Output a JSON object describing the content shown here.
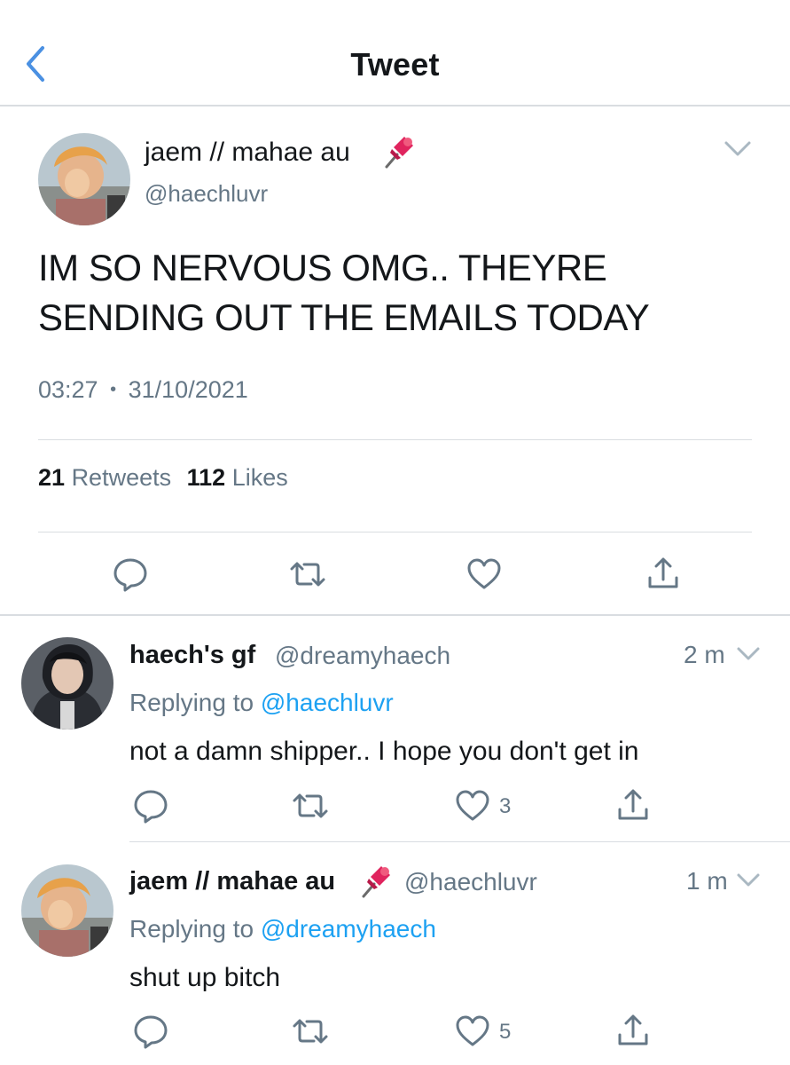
{
  "header": {
    "title": "Tweet"
  },
  "main_tweet": {
    "display_name": "jaem // mahae au",
    "badge_emoji": "📌",
    "handle": "@haechluvr",
    "text_line1": "IM SO NERVOUS OMG.. THEYRE",
    "text_line2": "SENDING OUT THE EMAILS TODAY",
    "time": "03:27",
    "separator": "•",
    "date": "31/10/2021",
    "retweets_count": "21",
    "retweets_label": "Retweets",
    "likes_count": "112",
    "likes_label": "Likes"
  },
  "replies": [
    {
      "display_name": "haech's gf",
      "handle": "@dreamyhaech",
      "time": "2 m",
      "replying_prefix": "Replying to",
      "replying_to": "@haechluvr",
      "text": "not a damn shipper.. I hope you don't get in",
      "like_count": "3"
    },
    {
      "display_name": "jaem // mahae au",
      "badge_emoji": "📌",
      "handle": "@haechluvr",
      "time": "1 m",
      "replying_prefix": "Replying to",
      "replying_to": "@dreamyhaech",
      "text": "shut up bitch",
      "like_count": "5"
    }
  ],
  "icons": {
    "back": "chevron-left-icon",
    "more": "chevron-down-icon",
    "reply": "reply-bubble-icon",
    "retweet": "retweet-icon",
    "like": "heart-icon",
    "share": "share-icon"
  },
  "colors": {
    "accent": "#1da1f2",
    "back_arrow": "#4a90e2",
    "muted_text": "#657786",
    "divider": "#d9dde1",
    "pin": "#e0245e"
  }
}
